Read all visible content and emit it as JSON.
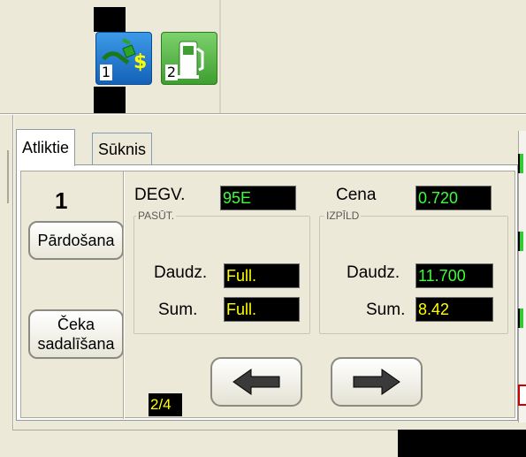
{
  "pumps": [
    {
      "number": "1",
      "icon": "nozzle-dollar-icon",
      "color": "#1a73c8"
    },
    {
      "number": "2",
      "icon": "fuel-pump-icon",
      "color": "#4caf3c"
    }
  ],
  "tabs": [
    {
      "label": "Atliktie",
      "active": true
    },
    {
      "label": "Sūknis",
      "active": false
    }
  ],
  "pump_number": "1",
  "buttons": {
    "sell": "Pārdošana",
    "split_line1": "Čeka",
    "split_line2": "sadalīšana"
  },
  "fuel": {
    "label": "DEGV.",
    "value": "95E"
  },
  "price": {
    "label": "Cena",
    "value": "0.720"
  },
  "order": {
    "group_label": "PASŪT.",
    "qty_label": "Daudz.",
    "qty_value": "Full.",
    "sum_label": "Sum.",
    "sum_value": "Full."
  },
  "done": {
    "group_label": "IZPĪLD",
    "qty_label": "Daudz.",
    "qty_value": "11.700",
    "sum_label": "Sum.",
    "sum_value": "8.42"
  },
  "page_indicator": "2/4",
  "colors": {
    "display_green": "#3aff3a",
    "display_yellow": "#ffff00"
  }
}
